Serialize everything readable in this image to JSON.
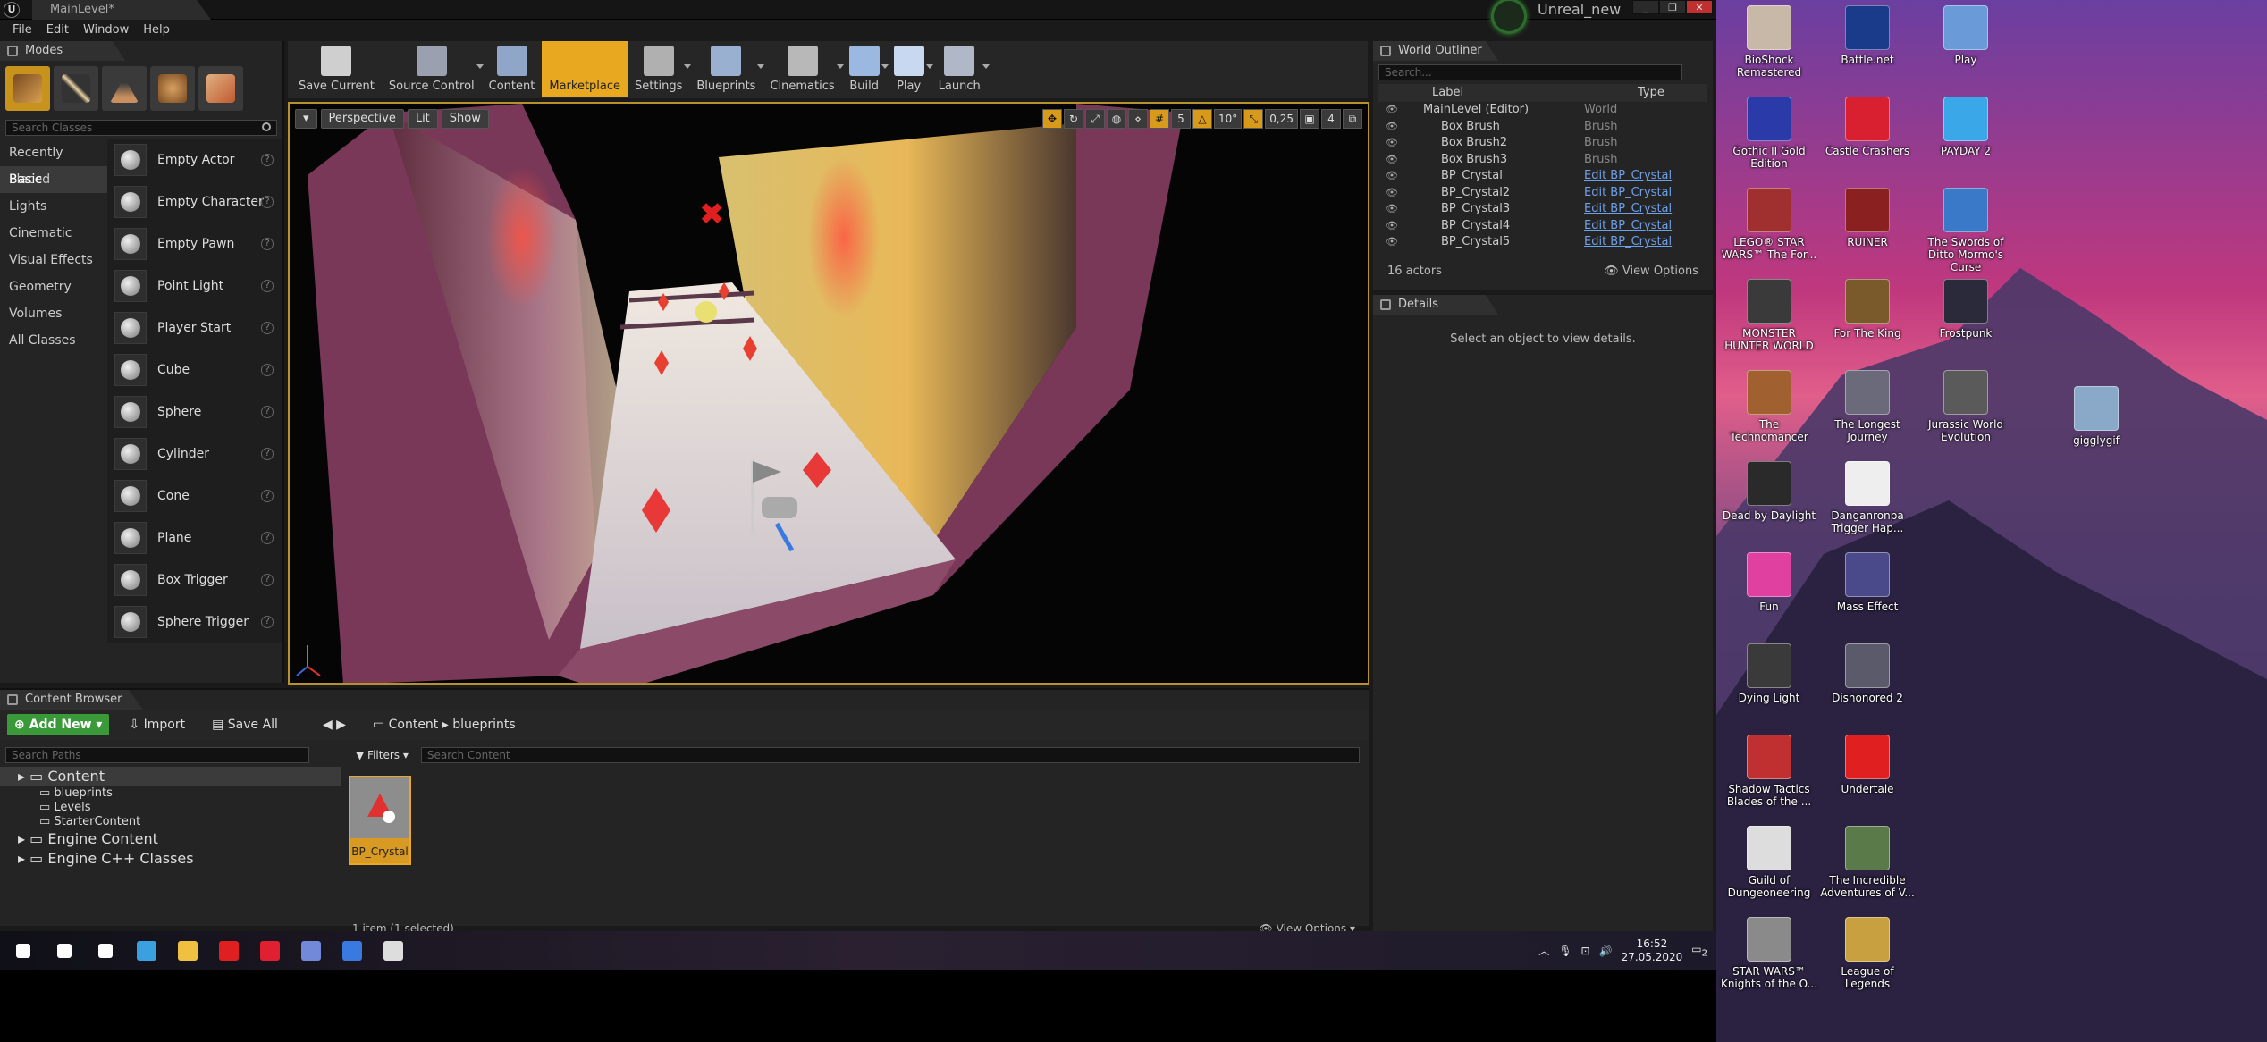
{
  "app": {
    "document_tab": "MainLevel*",
    "project_name": "Unreal_new",
    "menu": [
      "File",
      "Edit",
      "Window",
      "Help"
    ],
    "window_buttons": [
      "_",
      "❐",
      "✕"
    ]
  },
  "modes": {
    "tab": "Modes",
    "search_placeholder": "Search Classes",
    "categories": [
      "Recently Placed",
      "Basic",
      "Lights",
      "Cinematic",
      "Visual Effects",
      "Geometry",
      "Volumes",
      "All Classes"
    ],
    "selected_category": "Basic",
    "items": [
      "Empty Actor",
      "Empty Character",
      "Empty Pawn",
      "Point Light",
      "Player Start",
      "Cube",
      "Sphere",
      "Cylinder",
      "Cone",
      "Plane",
      "Box Trigger",
      "Sphere Trigger"
    ]
  },
  "toolbar": {
    "buttons": [
      {
        "label": "Save Current",
        "color": "#cfcfcf"
      },
      {
        "label": "Source Control",
        "color": "#9aa0b0"
      },
      {
        "label": "Content",
        "color": "#8fa6c8"
      },
      {
        "label": "Marketplace",
        "color": "#e8a820"
      },
      {
        "label": "Settings",
        "color": "#b0b0b0"
      },
      {
        "label": "Blueprints",
        "color": "#9ab0d0"
      },
      {
        "label": "Cinematics",
        "color": "#b8b8b8"
      },
      {
        "label": "Build",
        "color": "#9ab8e0"
      },
      {
        "label": "Play",
        "color": "#c8d8f0"
      },
      {
        "label": "Launch",
        "color": "#b0b8c8"
      }
    ]
  },
  "viewport": {
    "view_mode": "Perspective",
    "lighting": "Lit",
    "show": "Show",
    "grid_snap": "5",
    "rotation_snap": "10°",
    "scale_snap": "0,25",
    "camera_speed": "4",
    "accent": "#b8912c"
  },
  "outliner": {
    "tab": "World Outliner",
    "search_placeholder": "Search...",
    "col_label": "Label",
    "col_type": "Type",
    "rows": [
      {
        "label": "MainLevel (Editor)",
        "type": "World",
        "link": false
      },
      {
        "label": "Box Brush",
        "type": "Brush",
        "link": false
      },
      {
        "label": "Box Brush2",
        "type": "Brush",
        "link": false
      },
      {
        "label": "Box Brush3",
        "type": "Brush",
        "link": false
      },
      {
        "label": "BP_Crystal",
        "type": "Edit BP_Crystal",
        "link": true
      },
      {
        "label": "BP_Crystal2",
        "type": "Edit BP_Crystal",
        "link": true
      },
      {
        "label": "BP_Crystal3",
        "type": "Edit BP_Crystal",
        "link": true
      },
      {
        "label": "BP_Crystal4",
        "type": "Edit BP_Crystal",
        "link": true
      },
      {
        "label": "BP_Crystal5",
        "type": "Edit BP_Crystal",
        "link": true
      }
    ],
    "actor_count": "16 actors",
    "view_options": "View Options"
  },
  "details": {
    "tab": "Details",
    "message": "Select an object to view details."
  },
  "content_browser": {
    "tab": "Content Browser",
    "add_new": "Add New",
    "import": "Import",
    "save_all": "Save All",
    "breadcrumb": [
      "Content",
      "blueprints"
    ],
    "search_paths_placeholder": "Search Paths",
    "filters": "Filters",
    "search_content_placeholder": "Search Content",
    "tree": [
      {
        "label": "Content",
        "level": 1,
        "selected": true
      },
      {
        "label": "blueprints",
        "level": 2,
        "selected": false
      },
      {
        "label": "Levels",
        "level": 2,
        "selected": false
      },
      {
        "label": "StarterContent",
        "level": 2,
        "selected": false
      },
      {
        "label": "Engine Content",
        "level": 1,
        "selected": false
      },
      {
        "label": "Engine C++ Classes",
        "level": 1,
        "selected": false
      }
    ],
    "asset_name": "BP_Crystal",
    "status": "1 item (1 selected)",
    "view_options": "View Options"
  },
  "taskbar": {
    "apps": [
      {
        "name": "start",
        "color": "#ffffff"
      },
      {
        "name": "search",
        "color": "#ffffff"
      },
      {
        "name": "task-view",
        "color": "#ffffff"
      },
      {
        "name": "store",
        "color": "#3aa0e0"
      },
      {
        "name": "explorer",
        "color": "#f0c040"
      },
      {
        "name": "netflix",
        "color": "#e02020"
      },
      {
        "name": "opera",
        "color": "#e02030"
      },
      {
        "name": "discord",
        "color": "#7289da"
      },
      {
        "name": "maps",
        "color": "#3a7ae0"
      },
      {
        "name": "unreal",
        "color": "#dddddd"
      }
    ],
    "time": "16:52",
    "date": "27.05.2020",
    "notifications": "2"
  },
  "desktop": {
    "icons": [
      {
        "label": "BioShock Remastered",
        "color": "#c8b8a8"
      },
      {
        "label": "Battle.net",
        "color": "#1a3a8a"
      },
      {
        "label": "Play",
        "color": "#6a9ad8"
      },
      {
        "label": "Gothic II Gold Edition",
        "color": "#2a3aa8"
      },
      {
        "label": "Castle Crashers",
        "color": "#d82030"
      },
      {
        "label": "PAYDAY 2",
        "color": "#3aa8e8"
      },
      {
        "label": "LEGO® STAR WARS™ The For...",
        "color": "#a03030"
      },
      {
        "label": "RUINER",
        "color": "#8a2020"
      },
      {
        "label": "The Swords of Ditto Mormo's Curse",
        "color": "#3a78c8"
      },
      {
        "label": "MONSTER HUNTER WORLD",
        "color": "#3a3a3a"
      },
      {
        "label": "For The King",
        "color": "#7a5a2a"
      },
      {
        "label": "Frostpunk",
        "color": "#2a2a3a"
      },
      {
        "label": "The Technomancer",
        "color": "#a06030"
      },
      {
        "label": "The Longest Journey",
        "color": "#6a6a7a"
      },
      {
        "label": "Jurassic World Evolution",
        "color": "#5a5a5a"
      },
      {
        "label": "Dead by Daylight",
        "color": "#2a2a2a"
      },
      {
        "label": "Danganronpa Trigger Hap...",
        "color": "#eeeeee"
      },
      {
        "label": "Fun",
        "color": "#e040a0"
      },
      {
        "label": "Mass Effect",
        "color": "#4a4a8a"
      },
      {
        "label": "Dying Light",
        "color": "#3a3a3a"
      },
      {
        "label": "Dishonored 2",
        "color": "#5a5a6a"
      },
      {
        "label": "Shadow Tactics Blades of the ...",
        "color": "#c03030"
      },
      {
        "label": "Undertale",
        "color": "#e02020"
      },
      {
        "label": "Guild of Dungeoneering",
        "color": "#dddddd"
      },
      {
        "label": "The Incredible Adventures of V...",
        "color": "#5a7a4a"
      },
      {
        "label": "STAR WARS™ Knights of the O...",
        "color": "#8a8a8a"
      },
      {
        "label": "League of Legends",
        "color": "#c8a040"
      },
      {
        "label": "gigglygif",
        "color": "#8aa8c8"
      }
    ]
  }
}
